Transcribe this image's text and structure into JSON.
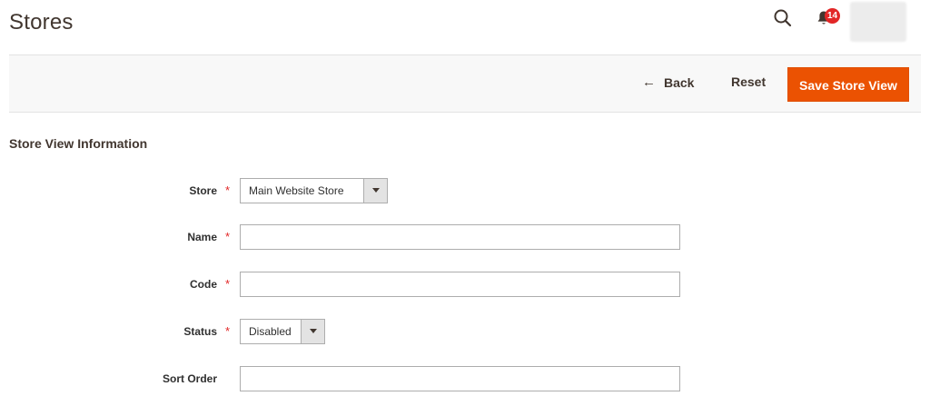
{
  "header": {
    "title": "Stores",
    "notifications_count": "14"
  },
  "actions": {
    "back_label": "Back",
    "back_arrow": "←",
    "reset_label": "Reset",
    "save_label": "Save Store View"
  },
  "colors": {
    "accent": "#eb5202",
    "badge": "#e22626",
    "required": "#e22626"
  },
  "section": {
    "title": "Store View Information"
  },
  "form": {
    "store": {
      "label": "Store",
      "required_mark": "*",
      "value": "Main Website Store"
    },
    "name": {
      "label": "Name",
      "required_mark": "*",
      "value": ""
    },
    "code": {
      "label": "Code",
      "required_mark": "*",
      "value": ""
    },
    "status": {
      "label": "Status",
      "required_mark": "*",
      "value": "Disabled"
    },
    "sort_order": {
      "label": "Sort Order",
      "value": ""
    }
  }
}
